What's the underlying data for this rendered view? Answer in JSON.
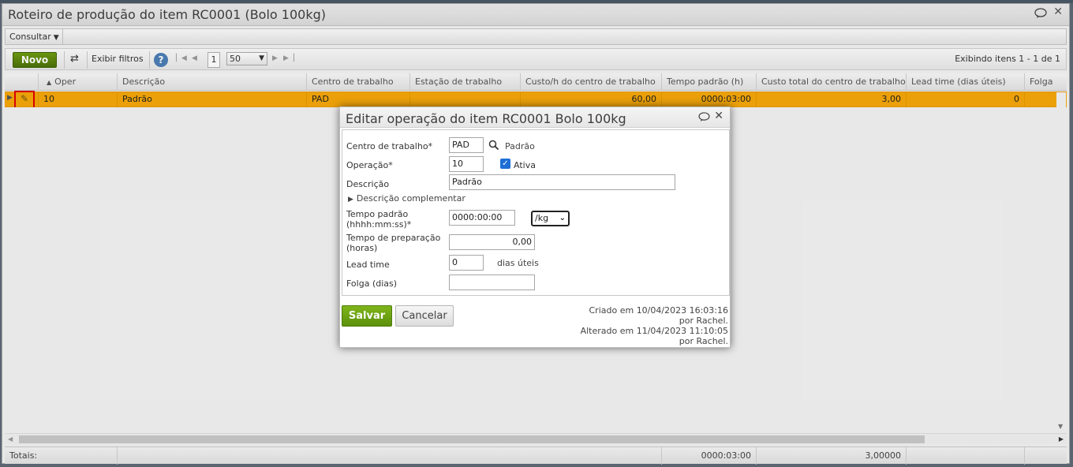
{
  "window": {
    "title": "Roteiro de produção do item RC0001 (Bolo 100kg)"
  },
  "menu": {
    "consultar": "Consultar"
  },
  "toolbar": {
    "novo": "Novo",
    "exibir_filtros": "Exibir filtros",
    "help": "?",
    "page_number": "1",
    "page_size": "50",
    "items_info": "Exibindo itens 1 - 1 de 1"
  },
  "grid": {
    "columns": [
      "Oper",
      "Descrição",
      "Centro de trabalho",
      "Estação de trabalho",
      "Custo/h do centro de trabalho",
      "Tempo padrão (h)",
      "Custo total do centro de trabalho",
      "Lead time (dias úteis)",
      "Folga"
    ],
    "row": {
      "oper": "10",
      "descricao": "Padrão",
      "centro": "PAD",
      "estacao": "",
      "custo_h": "60,00",
      "tempo": "0000:03:00",
      "custo_total": "3,00",
      "lead": "0",
      "folga": ""
    },
    "totals": {
      "label": "Totais:",
      "tempo": "0000:03:00",
      "custo_total": "3,00000"
    }
  },
  "dialog": {
    "title": "Editar operação do item RC0001 Bolo 100kg",
    "labels": {
      "centro": "Centro de trabalho*",
      "operacao": "Operação*",
      "descricao": "Descrição",
      "descricao_comp": "Descrição complementar",
      "tempo_1": "Tempo padrão",
      "tempo_2": "(hhhh:mm:ss)*",
      "prep_1": "Tempo de preparação",
      "prep_2": "(horas)",
      "lead": "Lead time",
      "folga": "Folga (dias)",
      "ativa": "Ativa",
      "dias_uteis": "dias úteis"
    },
    "values": {
      "centro": "PAD",
      "centro_lookup": "Padrão",
      "operacao": "10",
      "descricao": "Padrão",
      "tempo": "0000:00:00",
      "unidade": "/kg",
      "prep": "0,00",
      "lead": "0",
      "folga": ""
    },
    "buttons": {
      "salvar": "Salvar",
      "cancelar": "Cancelar"
    },
    "meta": {
      "criado": "Criado em 10/04/2023 16:03:16",
      "criado_por": "por Rachel.",
      "alterado": "Alterado em 11/04/2023 11:10:05",
      "alterado_por": "por Rachel."
    }
  }
}
